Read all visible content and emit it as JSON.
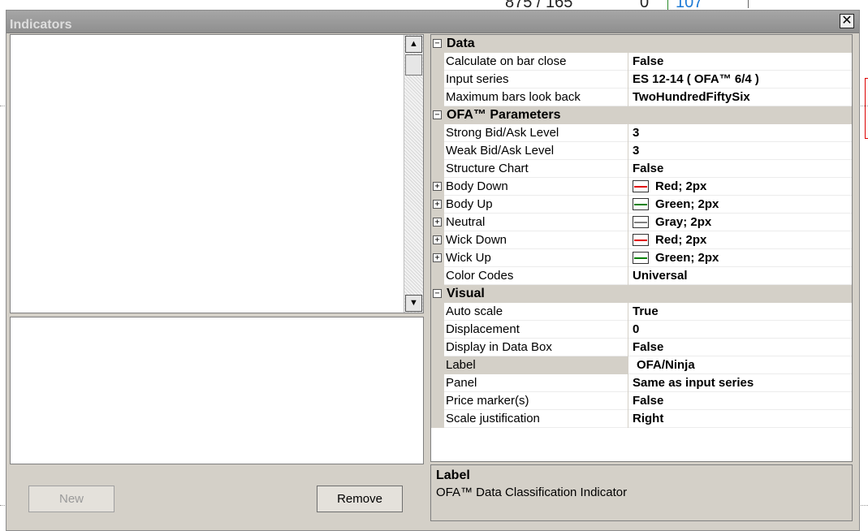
{
  "background": {
    "top_value_1": "875 / 165",
    "top_value_2": "0",
    "top_value_3": "107"
  },
  "dialog": {
    "title": "Indicators",
    "close_glyph": "✕"
  },
  "buttons": {
    "new_label": "New",
    "remove_label": "Remove"
  },
  "scrollbar": {
    "up_glyph": "▲",
    "down_glyph": "▼"
  },
  "grid": {
    "categories": [
      {
        "label": "Data",
        "rows": [
          {
            "name": "Calculate on bar close",
            "value": "False"
          },
          {
            "name": "Input series",
            "value": "ES 12-14 ( OFA™ 6/4 )"
          },
          {
            "name": "Maximum bars look back",
            "value": "TwoHundredFiftySix"
          }
        ]
      },
      {
        "label": "OFA™ Parameters",
        "rows": [
          {
            "name": "Strong Bid/Ask Level",
            "value": "3"
          },
          {
            "name": "Weak Bid/Ask Level",
            "value": "3"
          },
          {
            "name": "Structure Chart",
            "value": "False"
          },
          {
            "name": "Body Down",
            "value": "Red; 2px",
            "color": "#e00000"
          },
          {
            "name": "Body Up",
            "value": "Green; 2px",
            "color": "#008000"
          },
          {
            "name": "Neutral",
            "value": "Gray; 2px",
            "color": "#808080"
          },
          {
            "name": "Wick Down",
            "value": "Red; 2px",
            "color": "#e00000"
          },
          {
            "name": "Wick Up",
            "value": "Green; 2px",
            "color": "#008000"
          },
          {
            "name": "Color Codes",
            "value": "Universal"
          }
        ]
      },
      {
        "label": "Visual",
        "rows": [
          {
            "name": "Auto scale",
            "value": "True"
          },
          {
            "name": "Displacement",
            "value": "0"
          },
          {
            "name": "Display in Data Box",
            "value": "False"
          },
          {
            "name": "Label",
            "value": "OFA/Ninja",
            "selected": true
          },
          {
            "name": "Panel",
            "value": "Same as input series"
          },
          {
            "name": "Price marker(s)",
            "value": "False"
          },
          {
            "name": "Scale justification",
            "value": "Right"
          }
        ]
      }
    ],
    "collapse_glyph": "−",
    "expand_glyph": "+"
  },
  "description": {
    "title": "Label",
    "text": "OFA™ Data Classification Indicator"
  }
}
